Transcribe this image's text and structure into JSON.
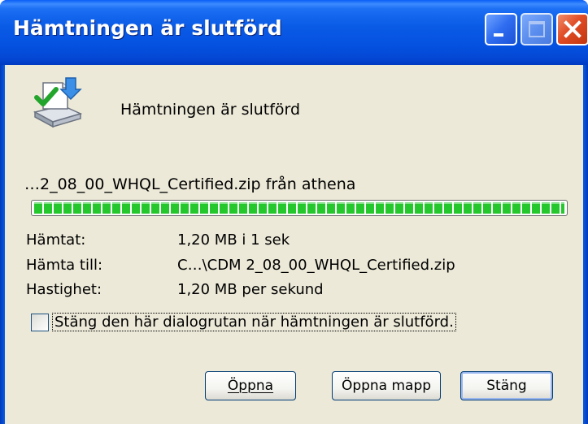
{
  "window": {
    "title": "Hämtningen är slutförd",
    "controls": {
      "minimize": "minimize-icon",
      "maximize": "maximize-icon",
      "close": "close-icon"
    }
  },
  "dialog": {
    "icon": "download-complete-icon",
    "heading": "Hämtningen är slutförd",
    "source_line": "…2_08_00_WHQL_Certified.zip från athena",
    "progress_fraction": 1.0,
    "info": {
      "downloaded_label": "Hämtat:",
      "downloaded_value": "1,20 MB i 1 sek",
      "destination_label": "Hämta till:",
      "destination_value": "C…\\CDM 2_08_00_WHQL_Certified.zip",
      "speed_label": "Hastighet:",
      "speed_value": "1,20 MB per sekund"
    },
    "close_on_complete": {
      "label": "Stäng den här dialogrutan när hämtningen är slutförd.",
      "checked": false
    },
    "buttons": {
      "open": "Öppna",
      "open_folder": "Öppna mapp",
      "close": "Stäng"
    }
  },
  "colors": {
    "titlebar": "#0a5be6",
    "client_bg": "#ece9d8",
    "progress": "#24c82c"
  }
}
